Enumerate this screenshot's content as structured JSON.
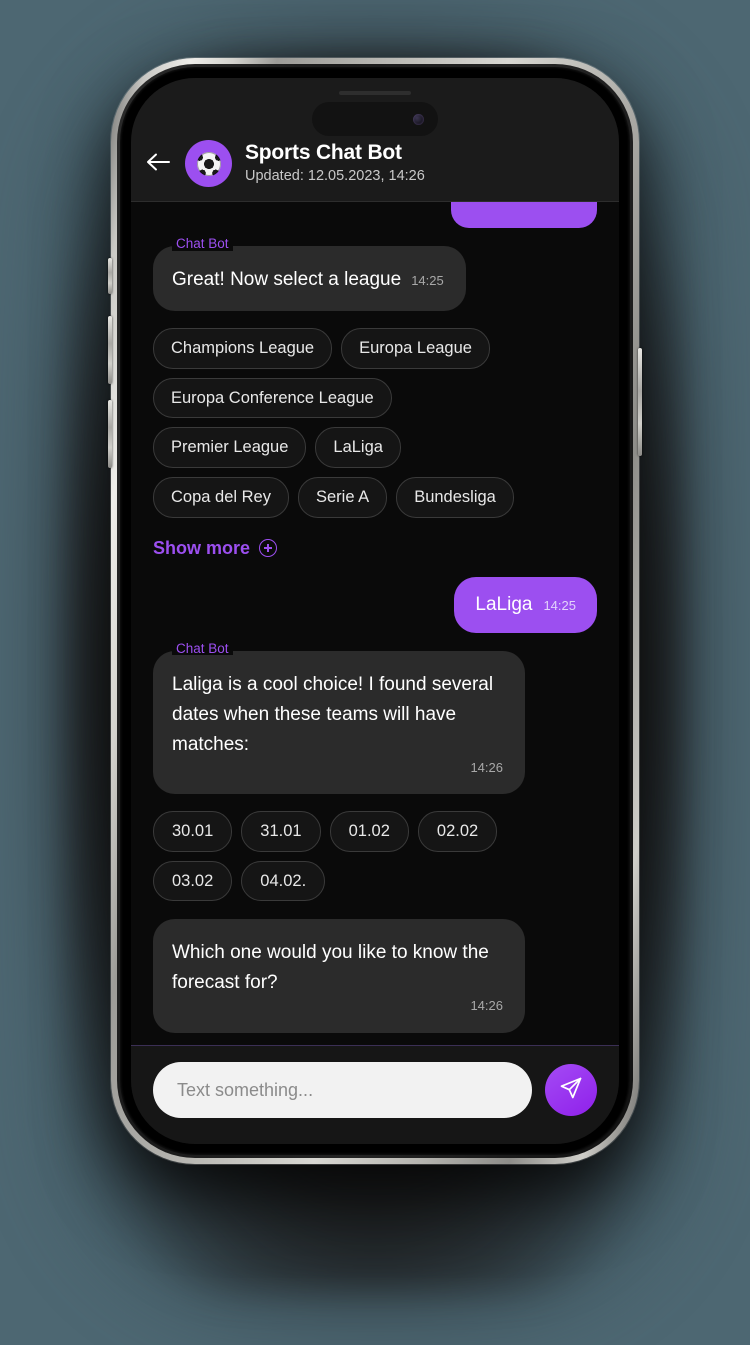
{
  "header": {
    "back_icon": "arrow-left-icon",
    "avatar_icon": "soccer-ball-icon",
    "title": "Sports Chat Bot",
    "subtitle": "Updated: 12.05.2023, 14:26"
  },
  "conversation": {
    "bot_label": "Chat Bot",
    "messages": [
      {
        "id": "bot-select-league",
        "sender": "bot",
        "text": "Great! Now select a league",
        "time": "14:25"
      },
      {
        "id": "user-laliga",
        "sender": "user",
        "text": "LaLiga",
        "time": "14:25"
      },
      {
        "id": "bot-dates-found",
        "sender": "bot",
        "text": "Laliga is a cool choice! I found several dates when these teams will have matches:",
        "time": "14:26"
      },
      {
        "id": "bot-which-forecast",
        "sender": "bot",
        "text": "Which one would you like to know the forecast for?",
        "time": "14:26"
      }
    ],
    "league_chips": [
      "Champions League",
      "Europa League",
      "Europa Conference League",
      "Premier League",
      "LaLiga",
      "Copa del Rey",
      "Serie A",
      "Bundesliga"
    ],
    "date_chips": [
      "30.01",
      "31.01",
      "01.02",
      "02.02",
      "03.02",
      "04.02."
    ],
    "show_more": {
      "label": "Show more",
      "icon": "plus-circle-icon"
    }
  },
  "composer": {
    "placeholder": "Text something...",
    "value": "",
    "send_icon": "send-paper-plane-icon"
  },
  "colors": {
    "accent_purple": "#9c4ff0",
    "send_purple": "#9c29f0",
    "bot_bubble": "#2b2b2b",
    "chip_bg": "#151515",
    "chip_border": "#3a3a3a",
    "screen_bg": "#0a0a0a",
    "header_bg": "#1b1b1b",
    "input_bg": "#f2f2f2",
    "page_bg": "#4d6772"
  }
}
